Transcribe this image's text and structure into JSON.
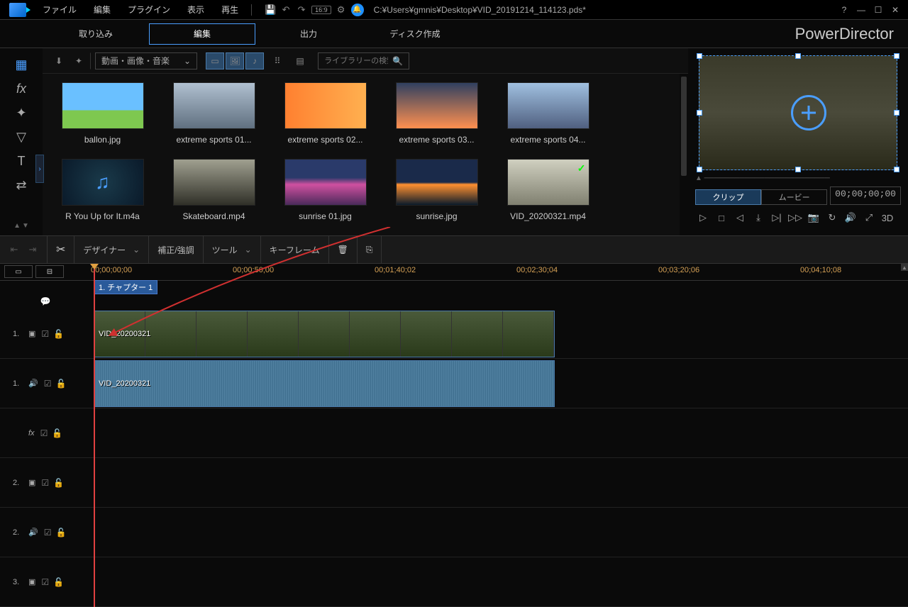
{
  "menu": [
    "ファイル",
    "編集",
    "プラグイン",
    "表示",
    "再生"
  ],
  "aspect": "16:9",
  "filepath": "C:¥Users¥gmnis¥Desktop¥VID_20191214_114123.pds*",
  "brand": "PowerDirector",
  "tabs": {
    "import": "取り込み",
    "edit": "編集",
    "output": "出力",
    "disc": "ディスク作成"
  },
  "library": {
    "filter": "動画・画像・音楽",
    "search_placeholder": "ライブラリーの検索",
    "items": [
      {
        "label": "ballon.jpg",
        "cls": "bg-balloon"
      },
      {
        "label": "extreme sports 01...",
        "cls": "bg-sport1"
      },
      {
        "label": "extreme sports 02...",
        "cls": "bg-sport2"
      },
      {
        "label": "extreme sports 03...",
        "cls": "bg-sport3"
      },
      {
        "label": "extreme sports 04...",
        "cls": "bg-sport4"
      },
      {
        "label": "R You Up for It.m4a",
        "cls": "music"
      },
      {
        "label": "Skateboard.mp4",
        "cls": "bg-skate"
      },
      {
        "label": "sunrise 01.jpg",
        "cls": "bg-sunrise1"
      },
      {
        "label": "sunrise.jpg",
        "cls": "bg-sunrise2"
      },
      {
        "label": "VID_20200321.mp4",
        "cls": "bg-vid",
        "checked": true
      }
    ]
  },
  "preview": {
    "tab_clip": "クリップ",
    "tab_movie": "ムービー",
    "timecode": "00;00;00;00",
    "td": "3D"
  },
  "edit_toolbar": {
    "designer": "デザイナー",
    "fix": "補正/強調",
    "tools": "ツール",
    "keyframe": "キーフレーム"
  },
  "timeline": {
    "ticks": [
      "00;00;00;00",
      "00;00;50;00",
      "00;01;40;02",
      "00;02;30;04",
      "00;03;20;06",
      "00;04;10;08"
    ],
    "chapter": "1. チャプター 1",
    "clip_video": "VID_20200321",
    "clip_audio": "VID_20200321",
    "tracks": [
      {
        "num": "1.",
        "type": "video"
      },
      {
        "num": "1.",
        "type": "audio"
      },
      {
        "num": "",
        "type": "fx"
      },
      {
        "num": "2.",
        "type": "video"
      },
      {
        "num": "2.",
        "type": "audio"
      },
      {
        "num": "3.",
        "type": "video"
      }
    ]
  }
}
